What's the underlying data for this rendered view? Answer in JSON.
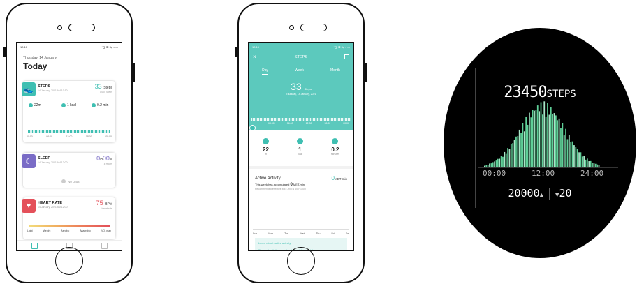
{
  "phone1": {
    "status": {
      "time": "10:10",
      "icons": "* ∑ ⊠ 3ᵢₗₗ ≈ ▭"
    },
    "date": "Thursday, 14 January",
    "title": "Today",
    "steps_card": {
      "name": "STEPS",
      "sub": "14 January, 2021 AM 10:10",
      "value": "33",
      "unit": "Steps",
      "goal": "8000 Steps",
      "stats": [
        {
          "icon": "location-icon",
          "text": "22m"
        },
        {
          "icon": "flame-icon",
          "text": "1 kcal"
        },
        {
          "icon": "clock-icon",
          "text": "0.2 min"
        }
      ],
      "axis": [
        "00:00",
        "06:00",
        "12:00",
        "18:00",
        "00:00"
      ]
    },
    "sleep_card": {
      "name": "SLEEP",
      "sub": "14 January, 2021 AM 12:00",
      "value": "0",
      "h": "H",
      "value2": "00",
      "m": "M",
      "goal": "8 Hours",
      "nodata": "No Data"
    },
    "heart_card": {
      "name": "HEART RATE",
      "sub": "14 January, 2021 AM 12:00",
      "value": "75",
      "unit": "BPM",
      "goal": "Heart rate",
      "zones": [
        "Light",
        "Weight",
        "Aerobic",
        "Anaerobic",
        "VO₂ max"
      ]
    }
  },
  "phone2": {
    "status": {
      "time": "10:10",
      "icons": "* ∑ ⊠ 3ᵢₗₗ ≈ ▭"
    },
    "title": "STEPS",
    "tabs": [
      "Day",
      "Week",
      "Month"
    ],
    "big_value": "33",
    "big_unit": "Steps",
    "date": "Thursday, 14 January, 2021",
    "axis": [
      "00:00",
      "06:00",
      "12:00",
      "18:00",
      "00:00"
    ],
    "metrics": [
      {
        "icon": "location-icon",
        "value": "22",
        "unit": "m"
      },
      {
        "icon": "flame-icon",
        "value": "1",
        "unit": "Kcal"
      },
      {
        "icon": "clock-icon",
        "value": "0.2",
        "unit": "minutes"
      }
    ],
    "active_title": "Active Activity",
    "active_value": "0",
    "active_unit": "MET-min",
    "accum_prefix": "This week has accumulated",
    "accum_value": "0",
    "accum_unit": "MET-min",
    "recommend": "Recommended effective MET-min is 600~1000",
    "days": [
      "Sun",
      "Mon",
      "Tue",
      "Wed",
      "Thu",
      "Fri",
      "Sat"
    ],
    "learn_title": "Learn about active activity",
    "learn_text": "Physical activity is moderate or higher and the"
  },
  "watch": {
    "steps_value": "23450",
    "steps_unit": "STEPS",
    "axis": [
      "00:00",
      "12:00",
      "24:00"
    ],
    "goal": "20000",
    "delta": "20"
  }
}
